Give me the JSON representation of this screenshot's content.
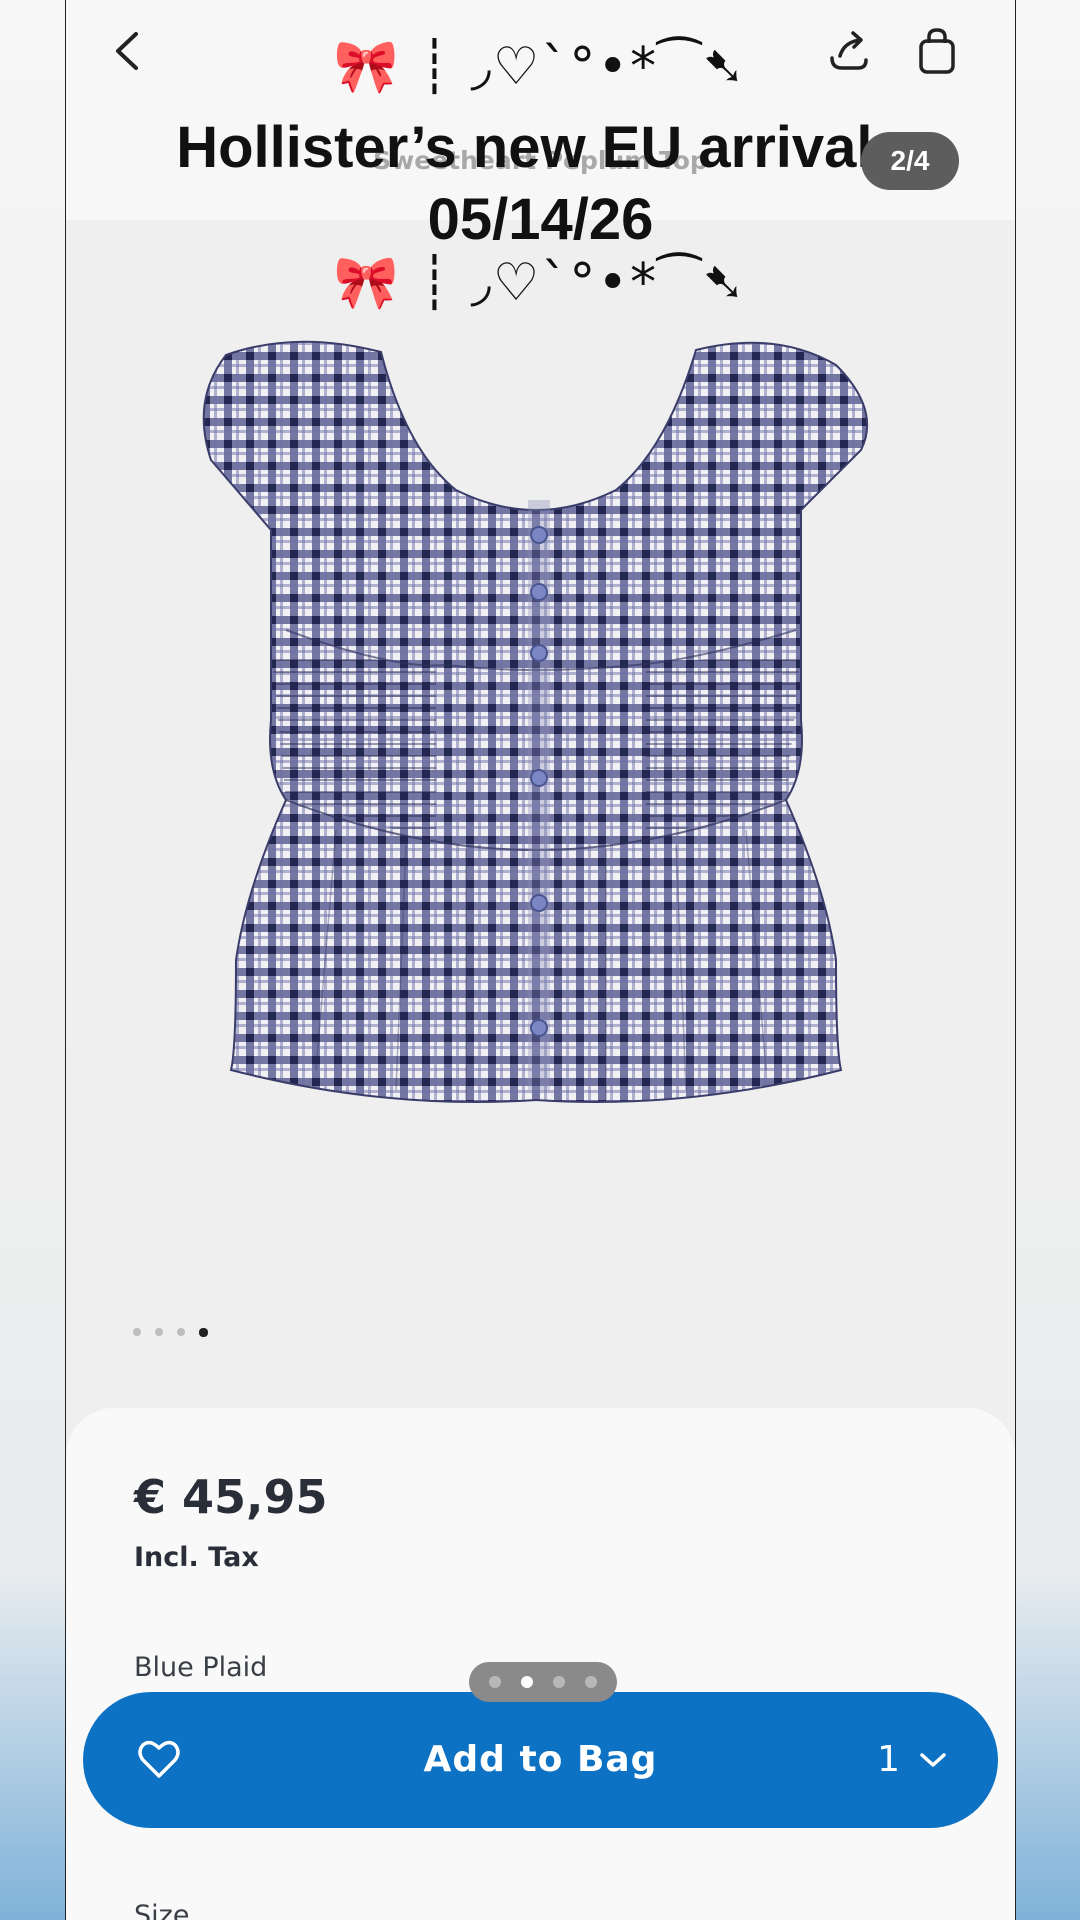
{
  "overlay": {
    "title_line1": "Hollister’s new EU arrivals",
    "title_line2": "05/14/26",
    "decoration": "🎀 ┊ ◞♡`°•*⁀➷",
    "slide_counter": "2/4"
  },
  "header": {
    "product_name": "Sweetheart Peplum Top",
    "icons": [
      "back-icon",
      "share-icon",
      "bag-icon"
    ]
  },
  "gallery": {
    "image_count": 4,
    "active_index": 4
  },
  "details": {
    "price": "€ 45,95",
    "tax_note": "Incl. Tax",
    "color_name": "Blue Plaid",
    "size_label": "Size"
  },
  "story": {
    "dot_count": 4,
    "active_index": 2
  },
  "cta": {
    "label": "Add to Bag",
    "quantity": "1",
    "color": "#0d72c3"
  }
}
